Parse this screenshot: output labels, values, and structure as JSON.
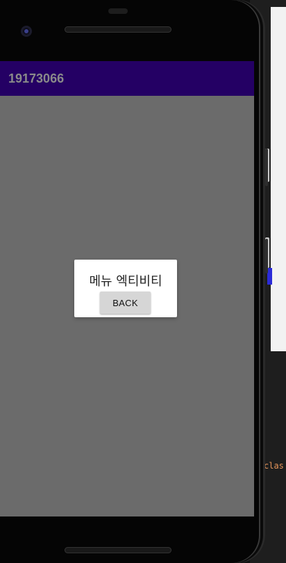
{
  "app_bar": {
    "title": "19173066",
    "background_color": "#240064",
    "title_color": "#8a8a8a"
  },
  "screen": {
    "background_color": "#6b6b6b"
  },
  "dialog": {
    "text": "메뉴 엑티비티",
    "back_button_label": "BACK"
  },
  "background_ide": {
    "visible_token": "clas"
  },
  "icons": {
    "front_camera": "front-camera-icon",
    "earpiece": "speaker-grille-icon"
  }
}
